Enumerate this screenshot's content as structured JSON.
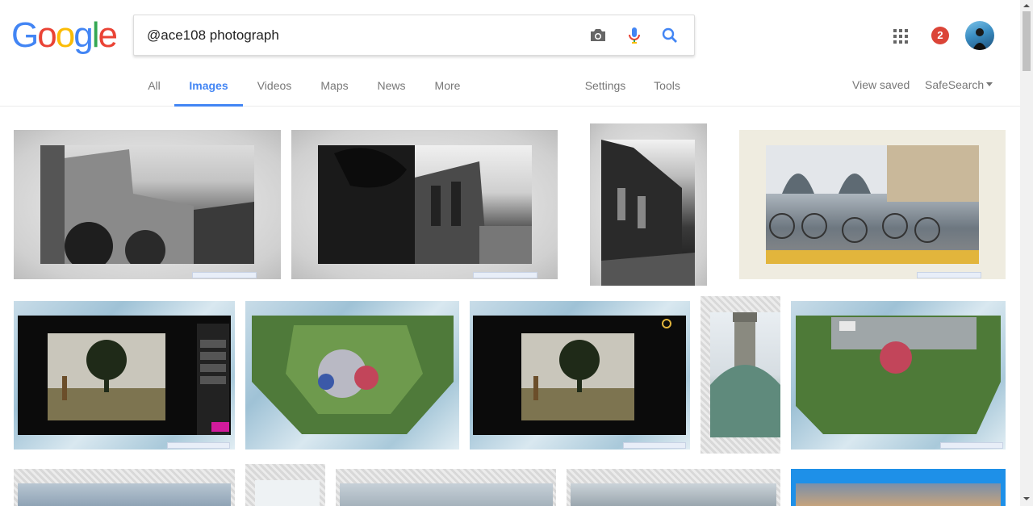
{
  "search": {
    "query": "@ace108 photograph"
  },
  "logo": {
    "letters": [
      "G",
      "o",
      "o",
      "g",
      "l",
      "e"
    ],
    "colors": [
      "#4285f4",
      "#ea4335",
      "#fbbc05",
      "#4285f4",
      "#34a853",
      "#ea4335"
    ]
  },
  "nav": {
    "tabs": [
      {
        "label": "All",
        "active": false
      },
      {
        "label": "Images",
        "active": true
      },
      {
        "label": "Videos",
        "active": false
      },
      {
        "label": "Maps",
        "active": false
      },
      {
        "label": "News",
        "active": false
      },
      {
        "label": "More",
        "active": false
      }
    ],
    "settings": "Settings",
    "tools": "Tools",
    "view_saved": "View saved",
    "safesearch": "SafeSearch"
  },
  "account": {
    "notification_count": "2"
  },
  "icons": {
    "camera": "camera-icon",
    "mic": "mic-icon",
    "search": "search-icon",
    "apps": "apps-grid-icon",
    "dropdown": "caret-down-icon"
  },
  "colors": {
    "accent": "#4285f4",
    "notification": "#db4437",
    "tab_text": "#777777"
  }
}
